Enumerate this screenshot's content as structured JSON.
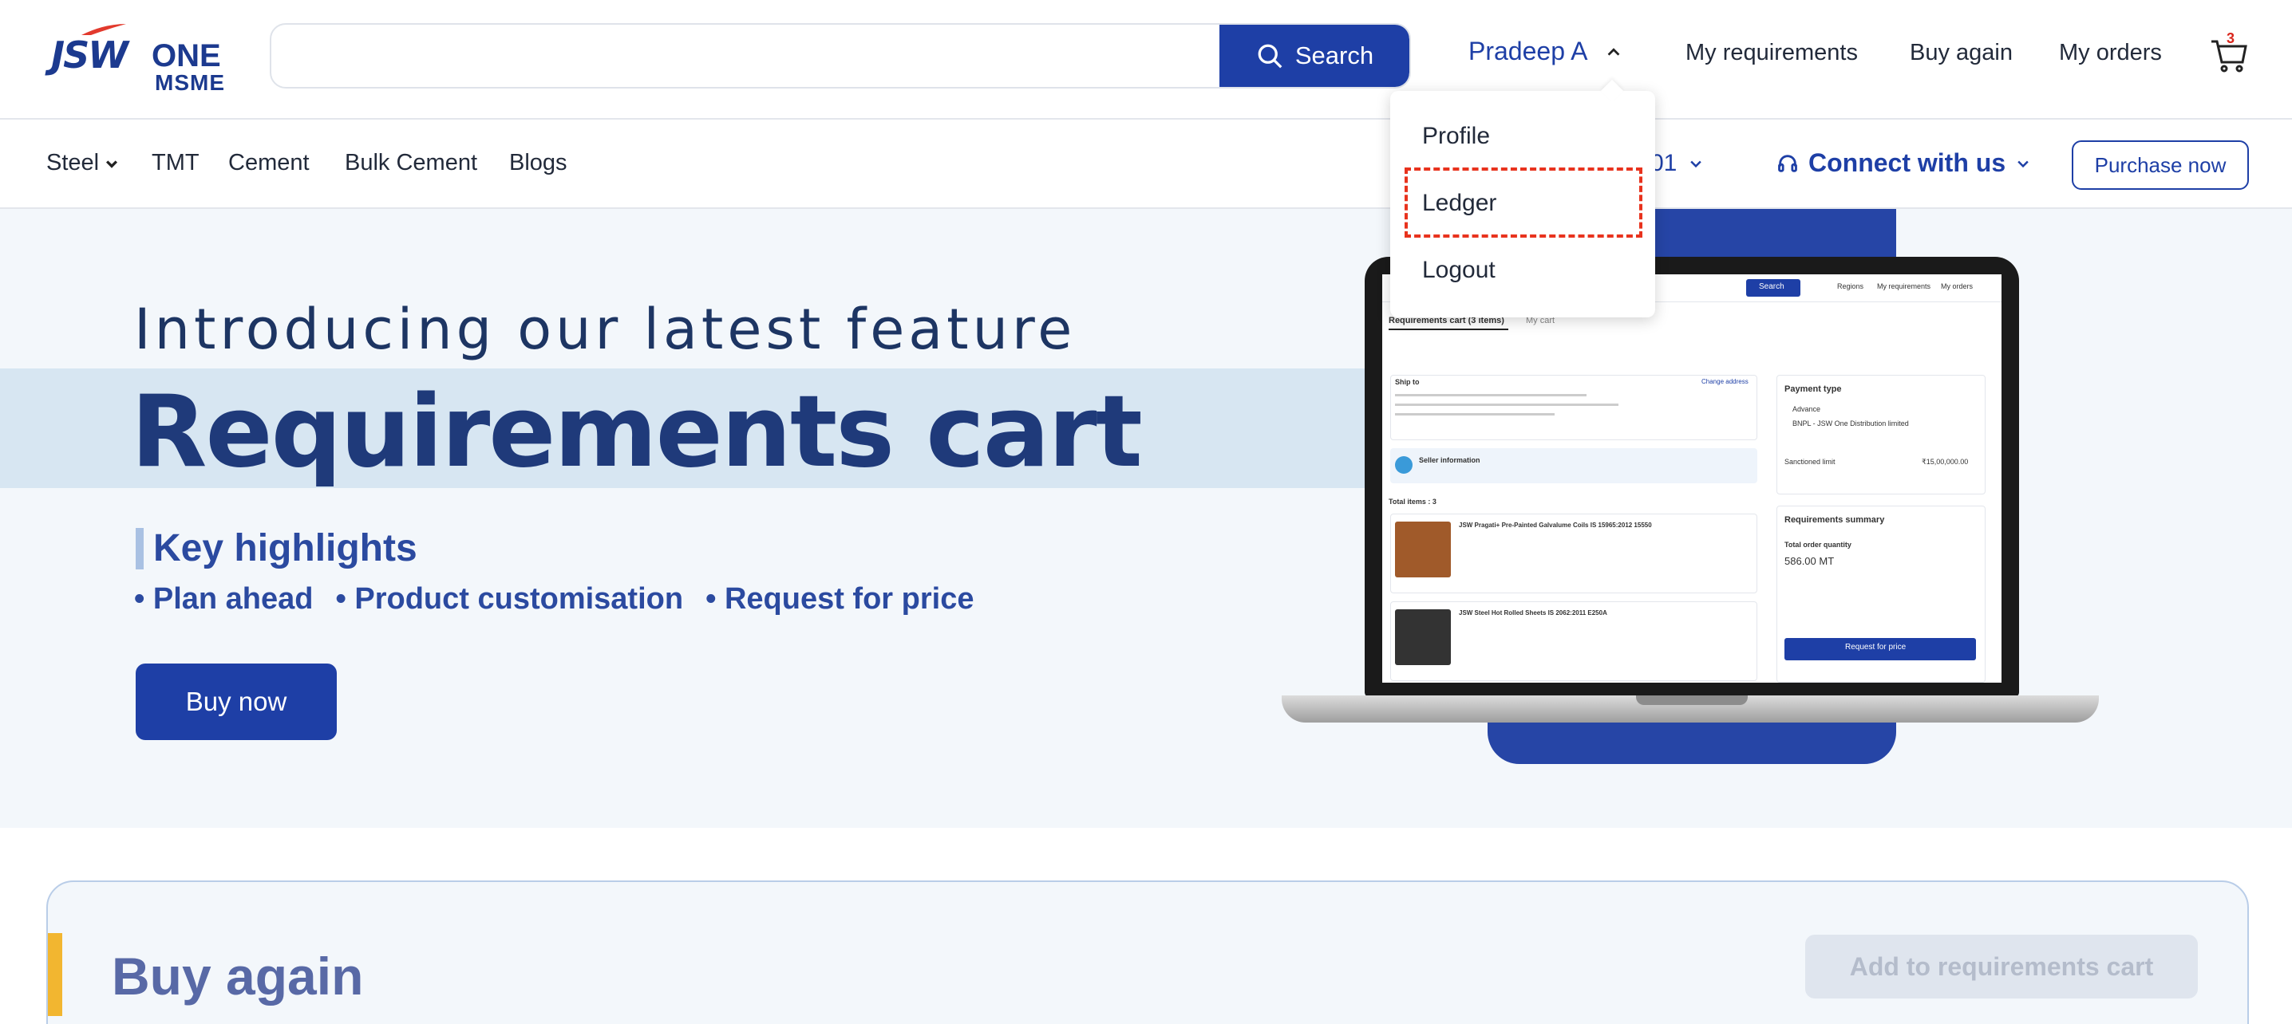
{
  "brand": {
    "logo_main": "JSW",
    "logo_one": "ONE",
    "logo_sub": "MSME"
  },
  "search": {
    "placeholder": "",
    "button_label": "Search"
  },
  "header": {
    "user_name": "Pradeep A",
    "links": [
      "My requirements",
      "Buy again",
      "My orders"
    ],
    "cart_count": "3"
  },
  "user_dropdown": {
    "items": [
      "Profile",
      "Ledger",
      "Logout"
    ],
    "highlighted": "Ledger"
  },
  "categories": [
    "Steel",
    "TMT",
    "Cement",
    "Bulk Cement",
    "Blogs"
  ],
  "location_fragment": "01",
  "connect_label": "Connect with us",
  "purchase_label": "Purchase now",
  "hero": {
    "intro": "Introducing our latest feature",
    "title": "Requirements cart",
    "highlights_title": "Key highlights",
    "highlights": [
      "• Plan ahead",
      "• Product customisation",
      "• Request for price"
    ],
    "cta": "Buy now"
  },
  "mockup": {
    "tab_active": "Requirements cart (3 items)",
    "tab_other": "My cart",
    "ship_to": "Ship to",
    "change_address": "Change address",
    "seller_info": "Seller information",
    "total_items": "Total items : 3",
    "item1": "JSW Pragati+ Pre-Painted Galvalume Coils IS 15965:2012 15550",
    "item2": "JSW Steel Hot Rolled Sheets IS 2062:2011 E250A",
    "payment_title": "Payment type",
    "payment_opt1": "Advance",
    "payment_opt2": "BNPL - JSW One Distribution limited",
    "sanctioned": "Sanctioned limit",
    "sanctioned_value": "₹15,00,000.00",
    "summary_title": "Requirements summary",
    "total_qty_label": "Total order quantity",
    "total_qty_value": "586.00 MT",
    "request_btn": "Request for price",
    "search_btn": "Search",
    "nav_regions": "Regions",
    "nav_reqs": "My requirements",
    "nav_orders": "My orders"
  },
  "buy_again": {
    "title": "Buy again",
    "button": "Add to requirements cart"
  },
  "colors": {
    "primary": "#1e3fa6",
    "accent_red": "#e8331e",
    "accent_yellow": "#f2b630",
    "hero_bg": "#f3f7fb"
  }
}
